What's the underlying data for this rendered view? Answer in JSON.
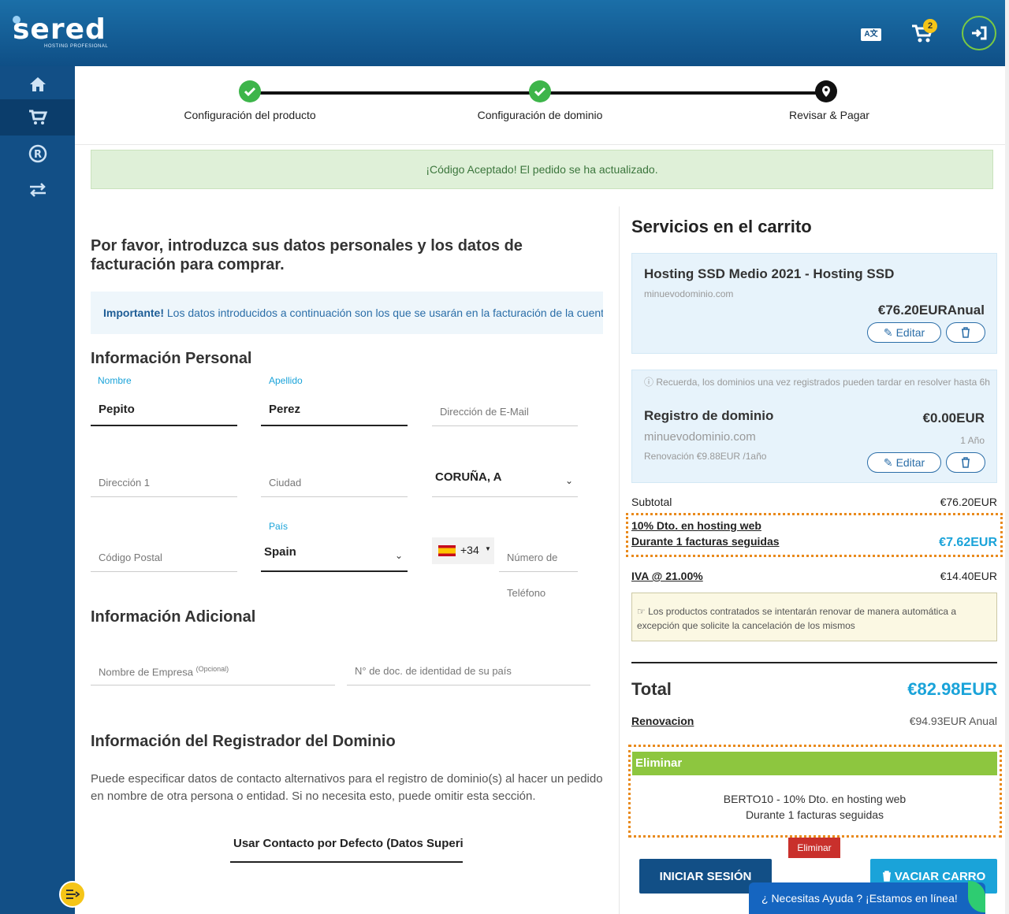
{
  "header": {
    "logo_text": "sered",
    "logo_sub": "HOSTING PROFESIONAL",
    "lang_icon": "translate-icon",
    "cart_count": "2",
    "login_icon": "sign-in-icon"
  },
  "sidebar": {
    "items": [
      {
        "icon": "home-icon"
      },
      {
        "icon": "cart-icon",
        "active": true
      },
      {
        "icon": "registered-icon"
      },
      {
        "icon": "transfer-icon"
      }
    ]
  },
  "steps": [
    {
      "label": "Configuración del producto",
      "state": "done"
    },
    {
      "label": "Configuración de dominio",
      "state": "done"
    },
    {
      "label": "Revisar & Pagar",
      "state": "current"
    }
  ],
  "alert": "¡Código Aceptado! El pedido se ha actualizado.",
  "form": {
    "heading": "Por favor, introduzca sus datos personales y los datos de facturación para comprar.",
    "important_label": "Importante!",
    "important_text": " Los datos introducidos a continuación son los que se usarán en la facturación de la cuenta",
    "personal_heading": "Información Personal",
    "nombre_label": "Nombre",
    "nombre_value": "Pepito",
    "apellido_label": "Apellido",
    "apellido_value": "Perez",
    "email_placeholder": "Dirección de E-Mail",
    "address_placeholder": "Dirección 1",
    "city_placeholder": "Ciudad",
    "region_value": "CORUÑA, A",
    "pais_label": "País",
    "pais_value": "Spain",
    "postal_placeholder": "Código Postal",
    "phone_code": "+34",
    "phone_placeholder": "Número de",
    "phone_placeholder_2": "Teléfono",
    "additional_heading": "Información Adicional",
    "company_placeholder": "Nombre de Empresa",
    "company_optional": "(Opcional)",
    "id_placeholder": "N° de doc. de identidad de su país",
    "registrar_heading": "Información del Registrador del Dominio",
    "registrar_text": "Puede especificar datos de contacto alternativos para el registro de dominio(s) al hacer un pedido en nombre de otra persona o entidad. Si no necesita esto, puede omitir esta sección.",
    "registrar_select": "Usar Contacto por Defecto (Datos Superiores)"
  },
  "cart": {
    "title": "Servicios en el carrito",
    "hosting": {
      "name": "Hosting SSD Medio 2021 - Hosting SSD",
      "domain": "minuevodominio.com",
      "price": "€76.20EUR",
      "cycle": "Anual",
      "edit_label": "Editar"
    },
    "domain": {
      "notice": "Recuerda, los dominios una vez registrados pueden tardar en resolver hasta 6h",
      "name": "Registro de dominio",
      "price": "€0.00EUR",
      "domain": "minuevodominio.com",
      "period": "1 Año",
      "renewal": "Renovación €9.88EUR /1año",
      "edit_label": "Editar"
    },
    "subtotal_label": "Subtotal",
    "subtotal_value": "€76.20EUR",
    "discount_line1": "10% Dto. en hosting web",
    "discount_line2": "Durante 1 facturas seguidas",
    "discount_value": "€7.62EUR",
    "tax_label": "IVA @ 21.00%",
    "tax_value": "€14.40EUR",
    "renew_notice": "Los productos contratados se intentarán renovar de manera automática a excepción que solicite la cancelación de los mismos",
    "total_label": "Total",
    "total_value": "€82.98EUR",
    "renewal_label": "Renovacion",
    "renewal_value": "€94.93EUR Anual",
    "remove_header": "Eliminar",
    "promo_line1": "BERTO10 - 10% Dto. en hosting web",
    "promo_line2": "Durante 1 facturas seguidas",
    "remove_button": "Eliminar",
    "login_button": "INICIAR SESIÓN",
    "empty_button": "VACIAR CARRO",
    "chat_text": "¿ Necesitas Ayuda ? ¡Estamos en línea!"
  },
  "colors": {
    "primary": "#124f86",
    "accent": "#1aa3d9",
    "success": "#3db54a",
    "promo_green": "#8dc63f",
    "danger": "#c9302c",
    "highlight": "#e98a1c"
  }
}
